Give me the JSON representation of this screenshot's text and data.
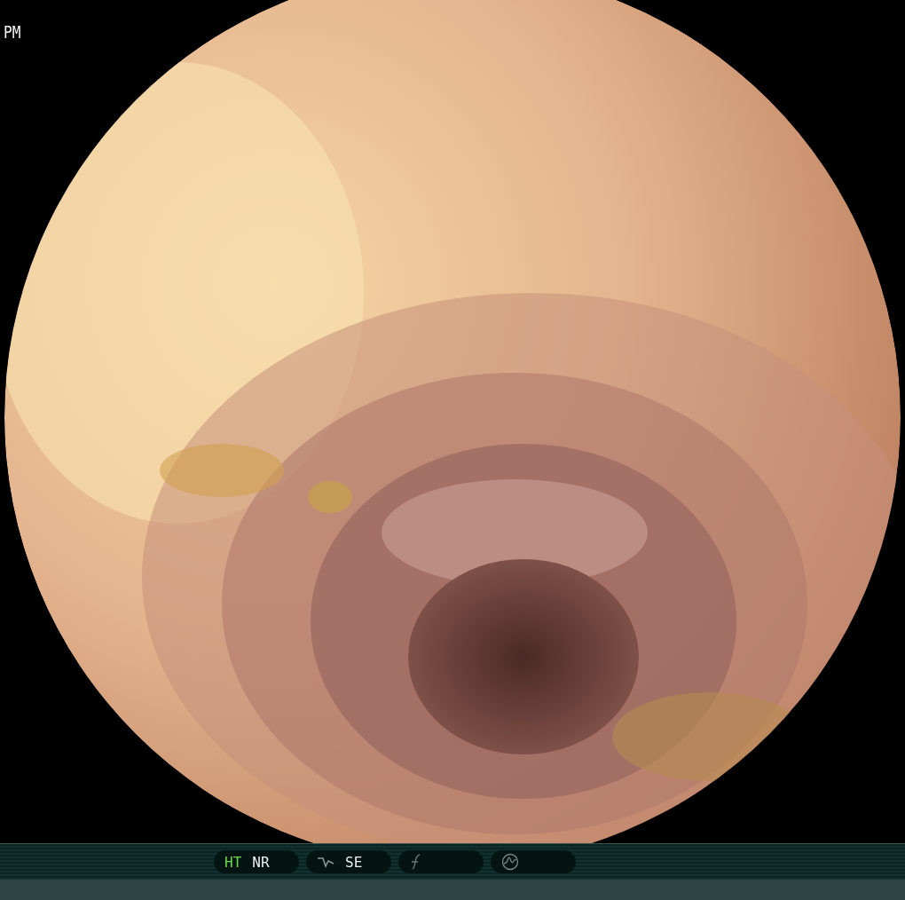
{
  "overlay": {
    "top_left": [
      "PM"
    ]
  },
  "status_bar": {
    "pills": [
      {
        "kind": "modes",
        "modes": [
          {
            "label": "HT",
            "on": true
          },
          {
            "label": "NR",
            "on": false
          }
        ]
      },
      {
        "kind": "curve",
        "modes": [
          {
            "label": "SE",
            "on": false
          }
        ]
      },
      {
        "kind": "freeze"
      },
      {
        "kind": "wave"
      }
    ]
  }
}
